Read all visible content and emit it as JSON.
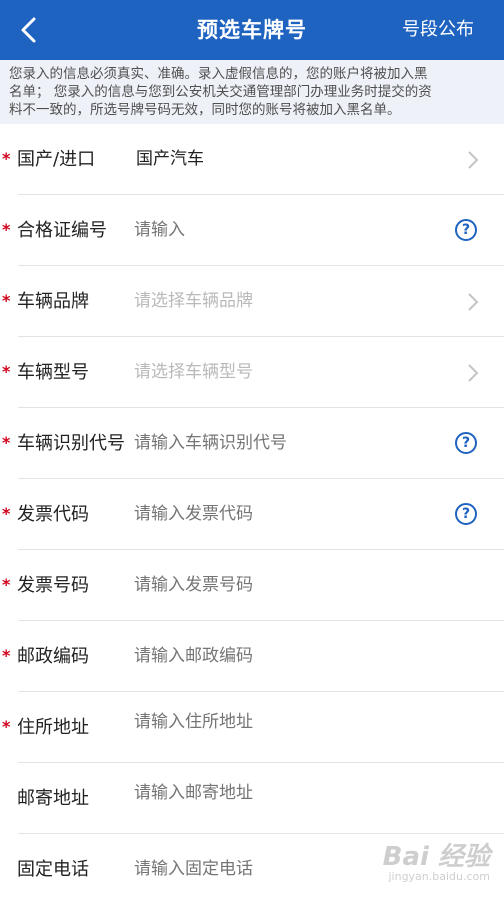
{
  "header": {
    "title": "预选车牌号",
    "link": "号段公布"
  },
  "notice": {
    "lines": [
      "您录入的信息必须真实、准确。录入虚假信息的，您的账户将被加入黑",
      "名单； 您录入的信息与您到公安机关交通管理部门办理业务时提交的资",
      "料不一致的，所选号牌号码无效，同时您的账号将被加入黑名单。"
    ]
  },
  "form": {
    "rows": [
      {
        "label": "国产/进口",
        "value": "国产汽车",
        "required": true,
        "accessory": "chevron"
      },
      {
        "label": "合格证编号",
        "placeholder": "请输入",
        "required": true,
        "accessory": "help"
      },
      {
        "label": "车辆品牌",
        "placeholder": "请选择车辆品牌",
        "required": true,
        "accessory": "chevron"
      },
      {
        "label": "车辆型号",
        "placeholder": "请选择车辆型号",
        "required": true,
        "accessory": "chevron"
      },
      {
        "label": "车辆识别代号",
        "placeholder": "请输入车辆识别代号",
        "required": true,
        "accessory": "help"
      },
      {
        "label": "发票代码",
        "placeholder": "请输入发票代码",
        "required": true,
        "accessory": "help"
      },
      {
        "label": "发票号码",
        "placeholder": "请输入发票号码",
        "required": true
      },
      {
        "label": "邮政编码",
        "placeholder": "请输入邮政编码",
        "required": true
      },
      {
        "label": "住所地址",
        "placeholder": "请输入住所地址",
        "required": true
      },
      {
        "label": "邮寄地址",
        "placeholder": "请输入邮寄地址",
        "required": false
      },
      {
        "label": "固定电话",
        "placeholder": "请输入固定电话",
        "required": false
      }
    ],
    "required_mark": "*",
    "help_glyph": "?"
  },
  "watermark": {
    "main": "Bai 经验",
    "sub": "jingyan.baidu.com"
  },
  "colors": {
    "brand": "#1f63c1",
    "required": "#d0021b",
    "placeholder": "#b9b9b9"
  }
}
